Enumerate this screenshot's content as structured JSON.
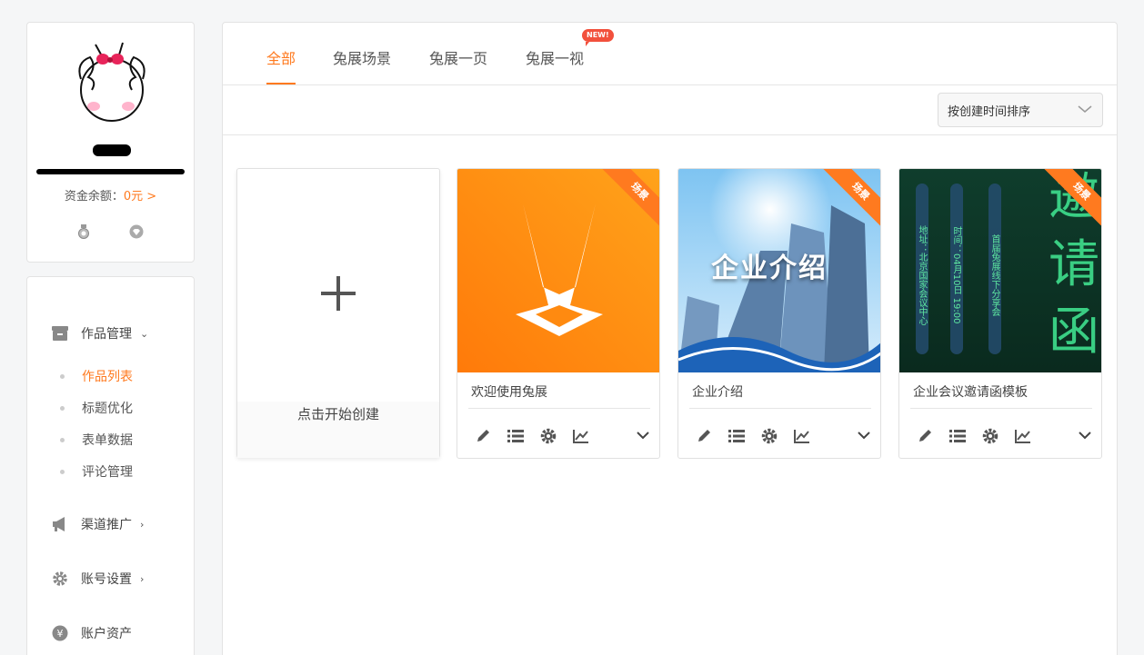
{
  "profile": {
    "balance_label": "资金余额：",
    "balance_value": "0元 >"
  },
  "menu": {
    "works": {
      "label": "作品管理"
    },
    "works_sub": [
      {
        "label": "作品列表",
        "active": true
      },
      {
        "label": "标题优化"
      },
      {
        "label": "表单数据"
      },
      {
        "label": "评论管理"
      }
    ],
    "channel": {
      "label": "渠道推广"
    },
    "account": {
      "label": "账号设置"
    },
    "assets": {
      "label": "账户资产"
    }
  },
  "tabs": [
    {
      "label": "全部",
      "active": true
    },
    {
      "label": "兔展场景"
    },
    {
      "label": "兔展一页"
    },
    {
      "label": "兔展一视",
      "badge": "NEW!"
    }
  ],
  "sort": {
    "selected": "按创建时间排序"
  },
  "create_card": {
    "label": "点击开始创建"
  },
  "works": [
    {
      "title": "欢迎使用兔展",
      "ribbon": "场景"
    },
    {
      "title": "企业介绍",
      "ribbon": "场景",
      "cover_text": "企业介绍"
    },
    {
      "title": "企业会议邀请函模板",
      "ribbon": "场景",
      "cover_cols": [
        "地址：北京国家会议中心",
        "时间：04月10日 19:00",
        "首届兔展线下分享会"
      ],
      "cover_big": [
        "邀",
        "请",
        "函"
      ]
    }
  ],
  "colors": {
    "accent": "#ff7a1f",
    "badge": "#f2503c"
  }
}
